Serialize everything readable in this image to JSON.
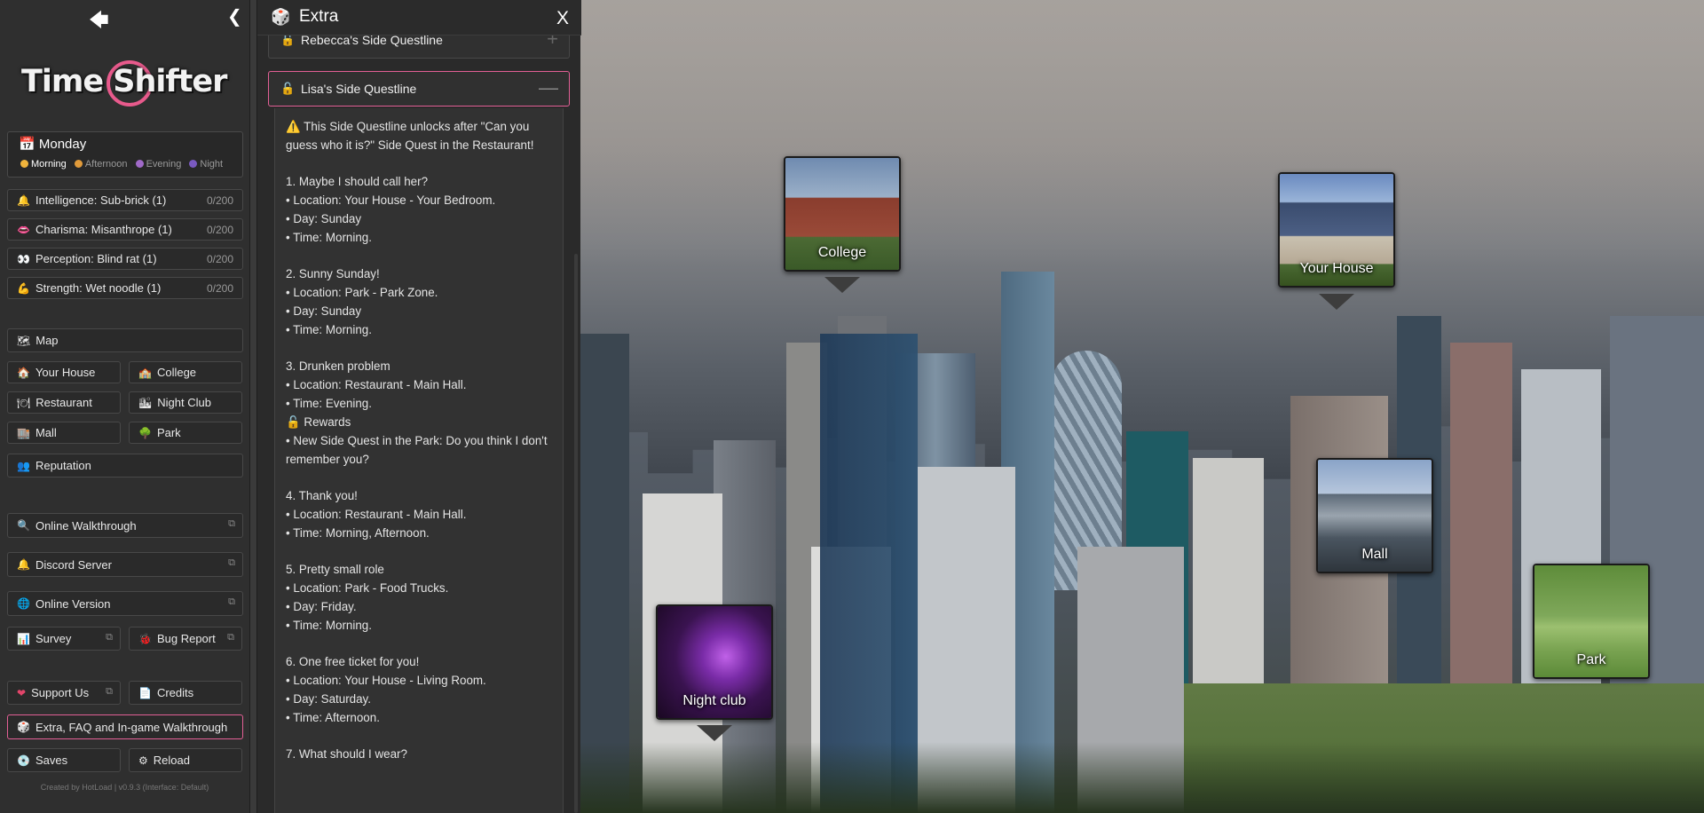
{
  "sidebar": {
    "back_icon": "arrow-left-icon",
    "collapse_icon": "chevron-left-icon",
    "logo_text": "Time Shifter",
    "day": "Monday",
    "times": [
      "Morning",
      "Afternoon",
      "Evening",
      "Night"
    ],
    "current_time": "Morning",
    "stats": [
      {
        "label": "Intelligence: Sub-brick (1)",
        "value": "0/200",
        "icon": "🔔"
      },
      {
        "label": "Charisma: Misanthrope (1)",
        "value": "0/200",
        "icon": "👄"
      },
      {
        "label": "Perception: Blind rat (1)",
        "value": "0/200",
        "icon": "👀"
      },
      {
        "label": "Strength: Wet noodle (1)",
        "value": "0/200",
        "icon": "💪"
      }
    ],
    "map_label": "Map",
    "locations": [
      "Your House",
      "College",
      "Restaurant",
      "Night Club",
      "Mall",
      "Park"
    ],
    "reputation_label": "Reputation",
    "links": [
      "Online Walkthrough",
      "Discord Server",
      "Online Version"
    ],
    "survey_label": "Survey",
    "bug_report_label": "Bug Report",
    "support_label": "Support Us",
    "credits_label": "Credits",
    "extra_label": "Extra, FAQ and In-game Walkthrough",
    "saves_label": "Saves",
    "reload_label": "Reload",
    "footer": "Created by HotLoad | v0.9.3 (Interface: Default)"
  },
  "panel": {
    "title": "Extra",
    "close_label": "X",
    "accordions": [
      {
        "label": "Rebecca's Side Questline",
        "sign": "+"
      },
      {
        "label": "Lisa's Side Questline",
        "sign": "—"
      }
    ],
    "intro_1": "This Side Questline unlocks after \"Can you",
    "intro_2": "guess who it is?\" Side Quest in the Restaurant!",
    "quests": [
      {
        "title": "1. Maybe I should call her?",
        "lines": [
          "• Location: Your House - Your Bedroom.",
          "• Day: Sunday",
          "• Time: Morning."
        ]
      },
      {
        "title": "2. Sunny Sunday!",
        "lines": [
          "• Location: Park - Park Zone.",
          "• Day: Sunday",
          "• Time: Morning."
        ]
      },
      {
        "title": "3. Drunken problem",
        "lines": [
          "• Location: Restaurant - Main Hall.",
          "• Time: Evening."
        ],
        "rewards_label": "Rewards",
        "reward_lines": [
          "• New Side Quest in the Park: Do you think I don't",
          "remember you?"
        ]
      },
      {
        "title": "4. Thank you!",
        "lines": [
          "• Location: Restaurant - Main Hall.",
          "• Time: Morning, Afternoon."
        ]
      },
      {
        "title": "5. Pretty small role",
        "lines": [
          "• Location: Park - Food Trucks.",
          "• Day: Friday.",
          "• Time: Morning."
        ]
      },
      {
        "title": "6. One free ticket for you!",
        "lines": [
          "• Location: Your House - Living Room.",
          "• Day: Saturday.",
          "• Time: Afternoon."
        ]
      },
      {
        "title": "7. What should I wear?",
        "lines": []
      }
    ]
  },
  "map": {
    "places": [
      "College",
      "Your House",
      "Mall",
      "Night club",
      "Park"
    ]
  },
  "colors": {
    "accent": "#e25f95",
    "panel_bg": "#2a2a2a",
    "sidebar_bg": "#2f2f2f"
  }
}
